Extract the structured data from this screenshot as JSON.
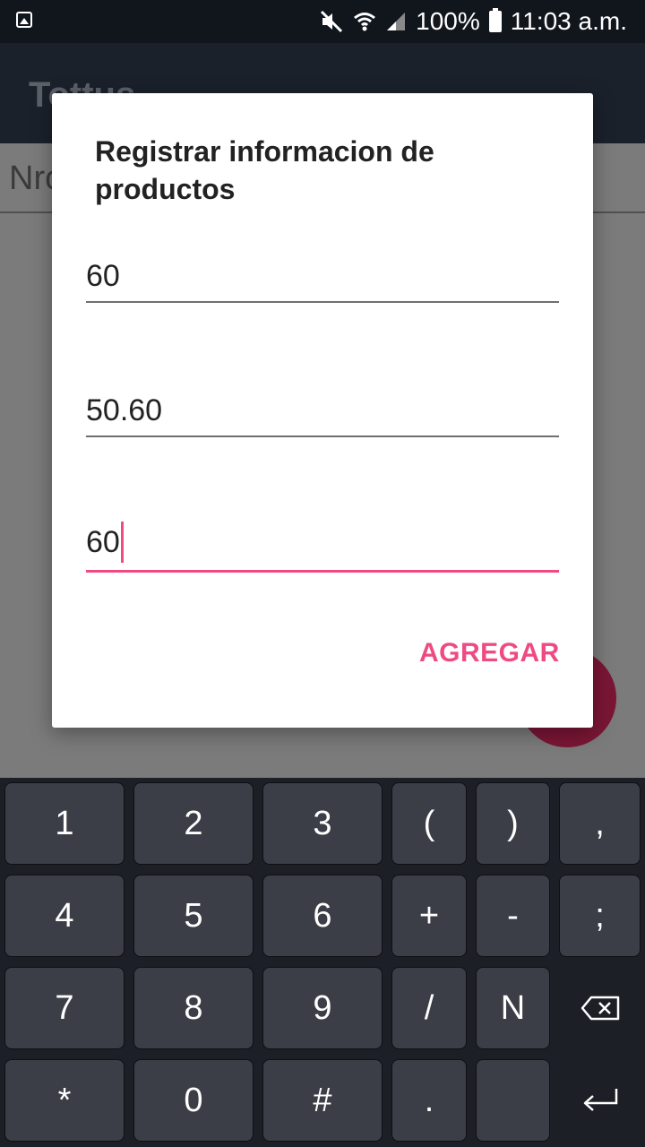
{
  "status_bar": {
    "battery_percent": "100%",
    "time": "11:03 a.m."
  },
  "background": {
    "app_title": "Tottus",
    "field_text": "Nro"
  },
  "dialog": {
    "title": "Registrar informacion de productos",
    "fields": [
      {
        "value": "60"
      },
      {
        "value": "50.60"
      },
      {
        "value": "60",
        "focused": true
      }
    ],
    "action_label": "AGREGAR",
    "accent_color": "#ee4b84"
  },
  "keyboard": {
    "rows": [
      [
        "1",
        "2",
        "3",
        "(",
        ")",
        ","
      ],
      [
        "4",
        "5",
        "6",
        "+",
        "-",
        ";"
      ],
      [
        "7",
        "8",
        "9",
        "/",
        "N",
        "backspace-icon"
      ],
      [
        "*",
        "0",
        "#",
        ".",
        "",
        "enter-icon"
      ]
    ]
  }
}
